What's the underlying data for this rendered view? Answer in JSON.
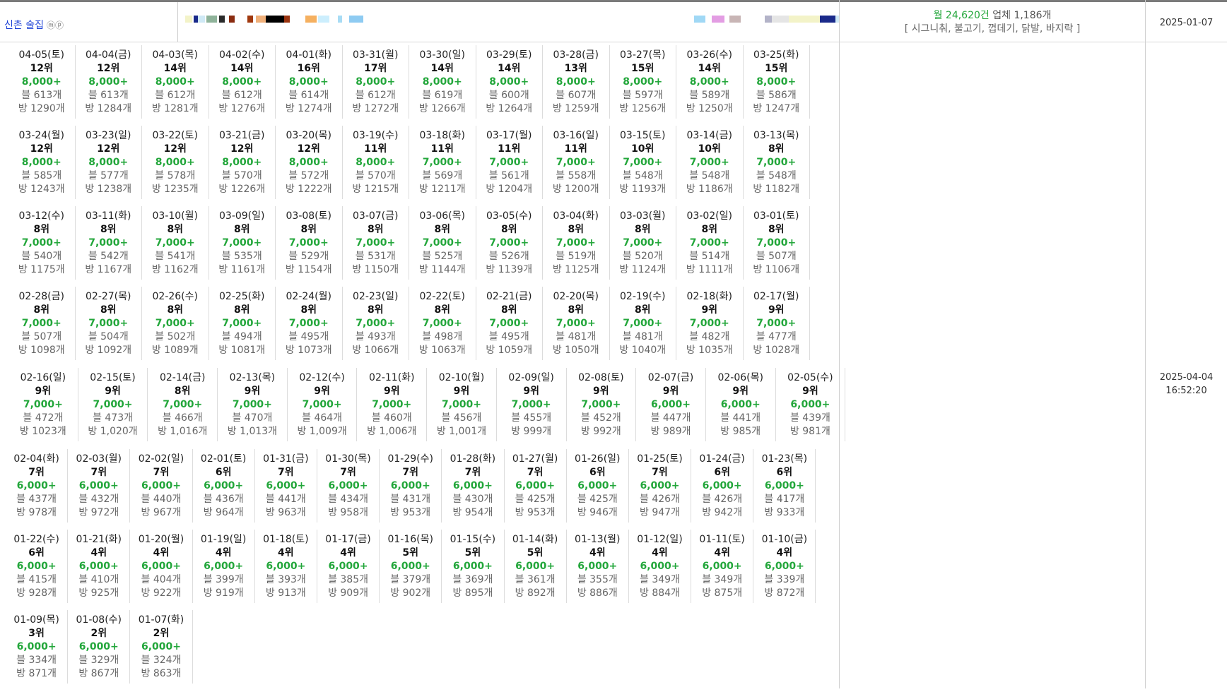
{
  "header": {
    "name": "신촌 술집",
    "name_suffix": "ⓜⓟ",
    "monthly_label": "월",
    "monthly_value": "24,620건",
    "business_label": "업체",
    "business_value": "1,186개",
    "keywords": "[ 시그니춰, 불고기, 껍데기, 닭발, 바지락 ]",
    "date": "2025-01-07"
  },
  "updated": {
    "date": "2025-04-04",
    "time": "16:52:20"
  },
  "colors": {
    "accent_green": "#22a63a",
    "name_blue": "#1a3fd6"
  },
  "strip_colors": [
    "#f3f3c8",
    "#1a2a8a",
    "#cfe9f5",
    "#8fb39a",
    "#2a2a2a",
    "#8a2c10",
    "#a0380e",
    "#f0b07a",
    "#000000",
    "#9a3410",
    "#f5b060",
    "#cceefd",
    "#a8dcf5",
    "#8ecbf2",
    "#a0d8f5",
    "#e39de3",
    "#c8b5b5",
    "#b3b3c8",
    "#e5e5e5"
  ],
  "rows": [
    [
      {
        "date": "04-05(토)",
        "rank": "12위",
        "count": "8,000+",
        "blog": "블 613개",
        "room": "방 1290개"
      },
      {
        "date": "04-04(금)",
        "rank": "12위",
        "count": "8,000+",
        "blog": "블 613개",
        "room": "방 1284개"
      },
      {
        "date": "04-03(목)",
        "rank": "14위",
        "count": "8,000+",
        "blog": "블 612개",
        "room": "방 1281개"
      },
      {
        "date": "04-02(수)",
        "rank": "14위",
        "count": "8,000+",
        "blog": "블 612개",
        "room": "방 1276개"
      },
      {
        "date": "04-01(화)",
        "rank": "16위",
        "count": "8,000+",
        "blog": "블 614개",
        "room": "방 1274개"
      },
      {
        "date": "03-31(월)",
        "rank": "17위",
        "count": "8,000+",
        "blog": "블 612개",
        "room": "방 1272개"
      },
      {
        "date": "03-30(일)",
        "rank": "14위",
        "count": "8,000+",
        "blog": "블 619개",
        "room": "방 1266개"
      },
      {
        "date": "03-29(토)",
        "rank": "14위",
        "count": "8,000+",
        "blog": "블 600개",
        "room": "방 1264개"
      },
      {
        "date": "03-28(금)",
        "rank": "13위",
        "count": "8,000+",
        "blog": "블 607개",
        "room": "방 1259개"
      },
      {
        "date": "03-27(목)",
        "rank": "15위",
        "count": "8,000+",
        "blog": "블 597개",
        "room": "방 1256개"
      },
      {
        "date": "03-26(수)",
        "rank": "14위",
        "count": "8,000+",
        "blog": "블 589개",
        "room": "방 1250개"
      },
      {
        "date": "03-25(화)",
        "rank": "15위",
        "count": "8,000+",
        "blog": "블 586개",
        "room": "방 1247개"
      }
    ],
    [
      {
        "date": "03-24(월)",
        "rank": "12위",
        "count": "8,000+",
        "blog": "블 585개",
        "room": "방 1243개"
      },
      {
        "date": "03-23(일)",
        "rank": "12위",
        "count": "8,000+",
        "blog": "블 577개",
        "room": "방 1238개"
      },
      {
        "date": "03-22(토)",
        "rank": "12위",
        "count": "8,000+",
        "blog": "블 578개",
        "room": "방 1235개"
      },
      {
        "date": "03-21(금)",
        "rank": "12위",
        "count": "8,000+",
        "blog": "블 570개",
        "room": "방 1226개"
      },
      {
        "date": "03-20(목)",
        "rank": "12위",
        "count": "8,000+",
        "blog": "블 572개",
        "room": "방 1222개"
      },
      {
        "date": "03-19(수)",
        "rank": "11위",
        "count": "8,000+",
        "blog": "블 570개",
        "room": "방 1215개"
      },
      {
        "date": "03-18(화)",
        "rank": "11위",
        "count": "7,000+",
        "blog": "블 569개",
        "room": "방 1211개"
      },
      {
        "date": "03-17(월)",
        "rank": "11위",
        "count": "7,000+",
        "blog": "블 561개",
        "room": "방 1204개"
      },
      {
        "date": "03-16(일)",
        "rank": "11위",
        "count": "7,000+",
        "blog": "블 558개",
        "room": "방 1200개"
      },
      {
        "date": "03-15(토)",
        "rank": "10위",
        "count": "7,000+",
        "blog": "블 548개",
        "room": "방 1193개"
      },
      {
        "date": "03-14(금)",
        "rank": "10위",
        "count": "7,000+",
        "blog": "블 548개",
        "room": "방 1186개"
      },
      {
        "date": "03-13(목)",
        "rank": "8위",
        "count": "7,000+",
        "blog": "블 548개",
        "room": "방 1182개"
      }
    ],
    [
      {
        "date": "03-12(수)",
        "rank": "8위",
        "count": "7,000+",
        "blog": "블 540개",
        "room": "방 1175개"
      },
      {
        "date": "03-11(화)",
        "rank": "8위",
        "count": "7,000+",
        "blog": "블 542개",
        "room": "방 1167개"
      },
      {
        "date": "03-10(월)",
        "rank": "8위",
        "count": "7,000+",
        "blog": "블 541개",
        "room": "방 1162개"
      },
      {
        "date": "03-09(일)",
        "rank": "8위",
        "count": "7,000+",
        "blog": "블 535개",
        "room": "방 1161개"
      },
      {
        "date": "03-08(토)",
        "rank": "8위",
        "count": "7,000+",
        "blog": "블 529개",
        "room": "방 1154개"
      },
      {
        "date": "03-07(금)",
        "rank": "8위",
        "count": "7,000+",
        "blog": "블 531개",
        "room": "방 1150개"
      },
      {
        "date": "03-06(목)",
        "rank": "8위",
        "count": "7,000+",
        "blog": "블 525개",
        "room": "방 1144개"
      },
      {
        "date": "03-05(수)",
        "rank": "8위",
        "count": "7,000+",
        "blog": "블 526개",
        "room": "방 1139개"
      },
      {
        "date": "03-04(화)",
        "rank": "8위",
        "count": "7,000+",
        "blog": "블 519개",
        "room": "방 1125개"
      },
      {
        "date": "03-03(월)",
        "rank": "8위",
        "count": "7,000+",
        "blog": "블 520개",
        "room": "방 1124개"
      },
      {
        "date": "03-02(일)",
        "rank": "8위",
        "count": "7,000+",
        "blog": "블 514개",
        "room": "방 1111개"
      },
      {
        "date": "03-01(토)",
        "rank": "8위",
        "count": "7,000+",
        "blog": "블 507개",
        "room": "방 1106개"
      }
    ],
    [
      {
        "date": "02-28(금)",
        "rank": "8위",
        "count": "7,000+",
        "blog": "블 507개",
        "room": "방 1098개"
      },
      {
        "date": "02-27(목)",
        "rank": "8위",
        "count": "7,000+",
        "blog": "블 504개",
        "room": "방 1092개"
      },
      {
        "date": "02-26(수)",
        "rank": "8위",
        "count": "7,000+",
        "blog": "블 502개",
        "room": "방 1089개"
      },
      {
        "date": "02-25(화)",
        "rank": "8위",
        "count": "7,000+",
        "blog": "블 494개",
        "room": "방 1081개"
      },
      {
        "date": "02-24(월)",
        "rank": "8위",
        "count": "7,000+",
        "blog": "블 495개",
        "room": "방 1073개"
      },
      {
        "date": "02-23(일)",
        "rank": "8위",
        "count": "7,000+",
        "blog": "블 493개",
        "room": "방 1066개"
      },
      {
        "date": "02-22(토)",
        "rank": "8위",
        "count": "7,000+",
        "blog": "블 498개",
        "room": "방 1063개"
      },
      {
        "date": "02-21(금)",
        "rank": "8위",
        "count": "7,000+",
        "blog": "블 495개",
        "room": "방 1059개"
      },
      {
        "date": "02-20(목)",
        "rank": "8위",
        "count": "7,000+",
        "blog": "블 481개",
        "room": "방 1050개"
      },
      {
        "date": "02-19(수)",
        "rank": "8위",
        "count": "7,000+",
        "blog": "블 481개",
        "room": "방 1040개"
      },
      {
        "date": "02-18(화)",
        "rank": "9위",
        "count": "7,000+",
        "blog": "블 482개",
        "room": "방 1035개"
      },
      {
        "date": "02-17(월)",
        "rank": "9위",
        "count": "7,000+",
        "blog": "블 477개",
        "room": "방 1028개"
      }
    ],
    [
      {
        "date": "02-16(일)",
        "rank": "9위",
        "count": "7,000+",
        "blog": "블 472개",
        "room": "방 1023개"
      },
      {
        "date": "02-15(토)",
        "rank": "9위",
        "count": "7,000+",
        "blog": "블 473개",
        "room": "방 1,020개"
      },
      {
        "date": "02-14(금)",
        "rank": "8위",
        "count": "7,000+",
        "blog": "블 466개",
        "room": "방 1,016개"
      },
      {
        "date": "02-13(목)",
        "rank": "9위",
        "count": "7,000+",
        "blog": "블 470개",
        "room": "방 1,013개"
      },
      {
        "date": "02-12(수)",
        "rank": "9위",
        "count": "7,000+",
        "blog": "블 464개",
        "room": "방 1,009개"
      },
      {
        "date": "02-11(화)",
        "rank": "9위",
        "count": "7,000+",
        "blog": "블 460개",
        "room": "방 1,006개"
      },
      {
        "date": "02-10(월)",
        "rank": "9위",
        "count": "7,000+",
        "blog": "블 456개",
        "room": "방 1,001개"
      },
      {
        "date": "02-09(일)",
        "rank": "9위",
        "count": "7,000+",
        "blog": "블 455개",
        "room": "방 999개"
      },
      {
        "date": "02-08(토)",
        "rank": "9위",
        "count": "7,000+",
        "blog": "블 452개",
        "room": "방 992개"
      },
      {
        "date": "02-07(금)",
        "rank": "9위",
        "count": "6,000+",
        "blog": "블 447개",
        "room": "방 989개"
      },
      {
        "date": "02-06(목)",
        "rank": "9위",
        "count": "6,000+",
        "blog": "블 441개",
        "room": "방 985개"
      },
      {
        "date": "02-05(수)",
        "rank": "9위",
        "count": "6,000+",
        "blog": "블 439개",
        "room": "방 981개"
      }
    ],
    [
      {
        "date": "02-04(화)",
        "rank": "7위",
        "count": "6,000+",
        "blog": "블 437개",
        "room": "방 978개"
      },
      {
        "date": "02-03(월)",
        "rank": "7위",
        "count": "6,000+",
        "blog": "블 432개",
        "room": "방 972개"
      },
      {
        "date": "02-02(일)",
        "rank": "7위",
        "count": "6,000+",
        "blog": "블 440개",
        "room": "방 967개"
      },
      {
        "date": "02-01(토)",
        "rank": "6위",
        "count": "6,000+",
        "blog": "블 436개",
        "room": "방 964개"
      },
      {
        "date": "01-31(금)",
        "rank": "7위",
        "count": "6,000+",
        "blog": "블 441개",
        "room": "방 963개"
      },
      {
        "date": "01-30(목)",
        "rank": "7위",
        "count": "6,000+",
        "blog": "블 434개",
        "room": "방 958개"
      },
      {
        "date": "01-29(수)",
        "rank": "7위",
        "count": "6,000+",
        "blog": "블 431개",
        "room": "방 953개"
      },
      {
        "date": "01-28(화)",
        "rank": "7위",
        "count": "6,000+",
        "blog": "블 430개",
        "room": "방 954개"
      },
      {
        "date": "01-27(월)",
        "rank": "7위",
        "count": "6,000+",
        "blog": "블 425개",
        "room": "방 953개"
      },
      {
        "date": "01-26(일)",
        "rank": "6위",
        "count": "6,000+",
        "blog": "블 425개",
        "room": "방 946개"
      },
      {
        "date": "01-25(토)",
        "rank": "7위",
        "count": "6,000+",
        "blog": "블 426개",
        "room": "방 947개"
      },
      {
        "date": "01-24(금)",
        "rank": "6위",
        "count": "6,000+",
        "blog": "블 426개",
        "room": "방 942개"
      },
      {
        "date": "01-23(목)",
        "rank": "6위",
        "count": "6,000+",
        "blog": "블 417개",
        "room": "방 933개"
      }
    ],
    [
      {
        "date": "01-22(수)",
        "rank": "6위",
        "count": "6,000+",
        "blog": "블 415개",
        "room": "방 928개"
      },
      {
        "date": "01-21(화)",
        "rank": "4위",
        "count": "6,000+",
        "blog": "블 410개",
        "room": "방 925개"
      },
      {
        "date": "01-20(월)",
        "rank": "4위",
        "count": "6,000+",
        "blog": "블 404개",
        "room": "방 922개"
      },
      {
        "date": "01-19(일)",
        "rank": "4위",
        "count": "6,000+",
        "blog": "블 399개",
        "room": "방 919개"
      },
      {
        "date": "01-18(토)",
        "rank": "4위",
        "count": "6,000+",
        "blog": "블 393개",
        "room": "방 913개"
      },
      {
        "date": "01-17(금)",
        "rank": "4위",
        "count": "6,000+",
        "blog": "블 385개",
        "room": "방 909개"
      },
      {
        "date": "01-16(목)",
        "rank": "5위",
        "count": "6,000+",
        "blog": "블 379개",
        "room": "방 902개"
      },
      {
        "date": "01-15(수)",
        "rank": "5위",
        "count": "6,000+",
        "blog": "블 369개",
        "room": "방 895개"
      },
      {
        "date": "01-14(화)",
        "rank": "5위",
        "count": "6,000+",
        "blog": "블 361개",
        "room": "방 892개"
      },
      {
        "date": "01-13(월)",
        "rank": "4위",
        "count": "6,000+",
        "blog": "블 355개",
        "room": "방 886개"
      },
      {
        "date": "01-12(일)",
        "rank": "4위",
        "count": "6,000+",
        "blog": "블 349개",
        "room": "방 884개"
      },
      {
        "date": "01-11(토)",
        "rank": "4위",
        "count": "6,000+",
        "blog": "블 349개",
        "room": "방 875개"
      },
      {
        "date": "01-10(금)",
        "rank": "4위",
        "count": "6,000+",
        "blog": "블 339개",
        "room": "방 872개"
      }
    ],
    [
      {
        "date": "01-09(목)",
        "rank": "3위",
        "count": "6,000+",
        "blog": "블 334개",
        "room": "방 871개"
      },
      {
        "date": "01-08(수)",
        "rank": "2위",
        "count": "6,000+",
        "blog": "블 329개",
        "room": "방 867개"
      },
      {
        "date": "01-07(화)",
        "rank": "2위",
        "count": "6,000+",
        "blog": "블 324개",
        "room": "방 863개"
      }
    ]
  ]
}
